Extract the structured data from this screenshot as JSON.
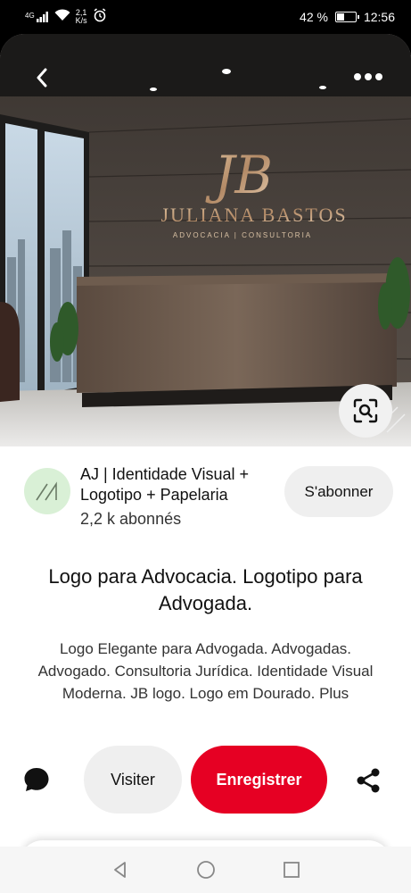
{
  "status_bar": {
    "signal": "4G",
    "speed_value": "2,1",
    "speed_unit": "K/s",
    "battery_percent": "42 %",
    "battery_level": 0.42,
    "time": "12:56"
  },
  "hero": {
    "logo_monogram": "JB",
    "logo_name": "JULIANA BASTOS",
    "logo_tagline": "ADVOCACIA | CONSULTORIA",
    "icons": {
      "back": "chevron-left-icon",
      "more": "more-horizontal-icon",
      "visual_search": "visual-search-icon"
    }
  },
  "creator": {
    "name": "AJ | Identidade Visual + Logotipo + Papelaria",
    "followers": "2,2 k abonnés",
    "follow_label": "S'abonner"
  },
  "pin": {
    "title": "Logo para Advocacia. Logotipo para Advogada.",
    "description": "Logo Elegante para Advogada. Advogadas. Advogado. Consultoria Jurídica. Identidade Visual Moderna. JB logo. Logo em Dourado. Plus"
  },
  "actions": {
    "visit_label": "Visiter",
    "save_label": "Enregistrer",
    "icons": {
      "comment": "comment-icon",
      "share": "share-icon"
    }
  },
  "colors": {
    "accent": "#e60023",
    "button_gray": "#efefef",
    "avatar_bg": "#d9f0d6"
  },
  "navbar": {
    "icons": [
      "back-triangle-icon",
      "home-circle-icon",
      "recents-square-icon"
    ]
  }
}
